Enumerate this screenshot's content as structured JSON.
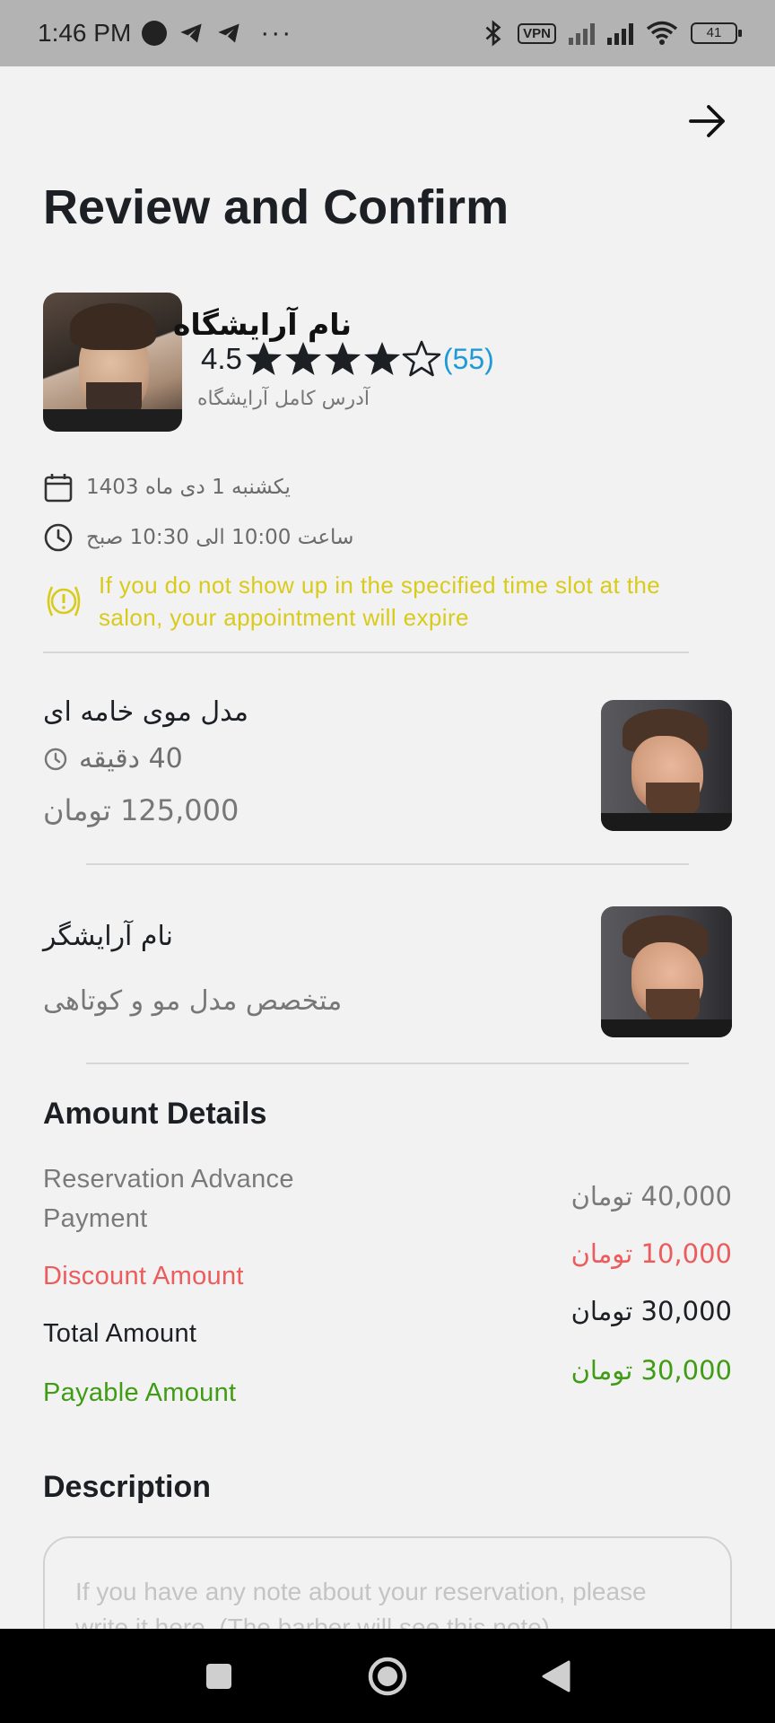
{
  "status_bar": {
    "time": "1:46 PM",
    "vpn_label": "VPN",
    "battery": "41",
    "more": "···"
  },
  "header": {
    "title": "Review and Confirm",
    "back_icon": "arrow-right-icon"
  },
  "salon": {
    "name": "نام آرایشگاه",
    "rating_value": "4.5",
    "rating_stars_filled": 4,
    "rating_stars_total": 5,
    "review_count": "(55)",
    "address": "آدرس کامل آرایشگاه"
  },
  "appointment": {
    "date": "یکشنبه 1 دی ماه 1403",
    "time": "ساعت 10:00 الی 10:30 صبح",
    "warning": "If you do not show up in the specified time slot at the salon, your appointment will expire"
  },
  "service": {
    "name": "مدل موی خامه ای",
    "duration": "40 دقیقه",
    "price": "125,000 تومان"
  },
  "barber": {
    "name": "نام آرایشگر",
    "specialty": "متخصص مدل مو و کوتاهی"
  },
  "amount_details": {
    "title": "Amount Details",
    "rows": [
      {
        "label": "Reservation Advance Payment",
        "value": "40,000 تومان",
        "color": "#7a7a7a"
      },
      {
        "label": "Discount Amount",
        "value": "10,000 تومان",
        "color": "#ec5c5c"
      },
      {
        "label": "Total Amount",
        "value": "30,000 تومان",
        "color": "#1c1f23"
      },
      {
        "label": "Payable Amount",
        "value": "30,000 تومان",
        "color": "#3f9c14"
      }
    ]
  },
  "description": {
    "title": "Description",
    "placeholder": "If you have any note about your reservation, please write it here. (The barber will see this note)"
  },
  "colors": {
    "accent_blue": "#1e9ad6",
    "warning_yellow": "#d9cb1c",
    "discount_red": "#ec5c5c",
    "payable_green": "#3f9c14"
  }
}
